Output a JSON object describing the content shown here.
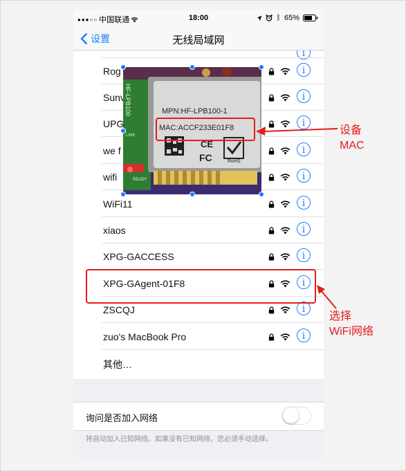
{
  "statusbar": {
    "carrier": "中国联通",
    "time": "18:00",
    "battery": "65%"
  },
  "navbar": {
    "back_label": "设置",
    "title": "无线局域网"
  },
  "networks": [
    {
      "name": "Rog"
    },
    {
      "name": "Sunv"
    },
    {
      "name": "UPG"
    },
    {
      "name": "we f"
    },
    {
      "name": "wifi"
    },
    {
      "name": "WiFi11"
    },
    {
      "name": "xiaos"
    },
    {
      "name": "XPG-GACCESS"
    },
    {
      "name": "XPG-GAgent-01F8"
    },
    {
      "name": "ZSCQJ"
    },
    {
      "name": "zuo's MacBook Pro"
    }
  ],
  "other_label": "其他…",
  "ask_to_join": {
    "label": "询问是否加入网络",
    "enabled": false
  },
  "footnote": "将自动加入已知网络。如果没有已知网络，您必须手动选择。",
  "module_photo": {
    "mpn": "MPN:HF-LPB100-1",
    "mac": "MAC:ACCF233E01F8",
    "ce": "CE",
    "fc": "FC",
    "rohs": "RoHS",
    "side_text": "HF-LPB100",
    "link_text": "LINK",
    "ready_text": "READY"
  },
  "annotations": {
    "mac_label": "设备\nMAC",
    "select_label": "选择\nWiFi网络"
  },
  "colors": {
    "accent": "#1f7bff",
    "annotation": "#e21c1c"
  }
}
